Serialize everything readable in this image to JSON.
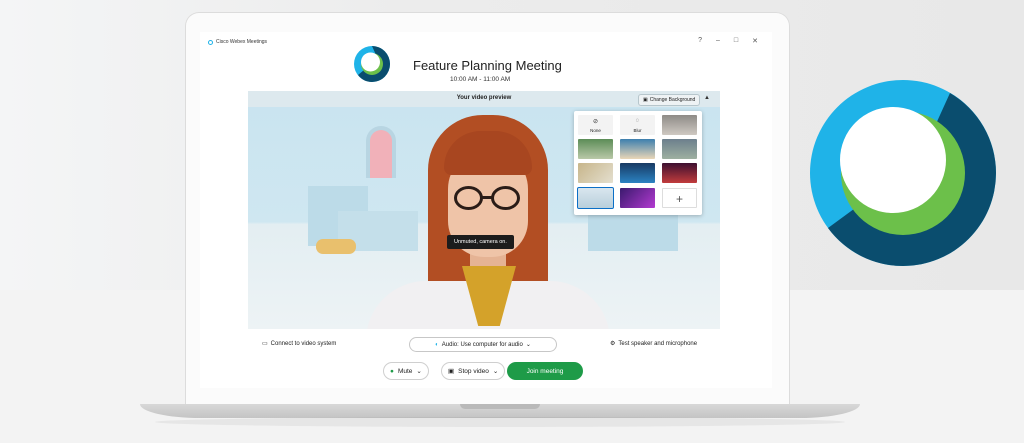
{
  "window": {
    "app_name": "Cisco Webex Meetings",
    "controls": [
      "?",
      "–",
      "□",
      "✕"
    ]
  },
  "meeting": {
    "title": "Feature Planning Meeting",
    "time": "10:00 AM - 11:00 AM"
  },
  "preview": {
    "title": "Your video preview",
    "change_background_label": "Change Background",
    "toast": "Unmuted, camera on.",
    "backgrounds": [
      {
        "label": "None",
        "icon": "⊘"
      },
      {
        "label": "Blur",
        "icon": "◌"
      },
      {
        "label": "",
        "icon": ""
      },
      {
        "label": "",
        "icon": ""
      },
      {
        "label": "",
        "icon": ""
      },
      {
        "label": "",
        "icon": ""
      },
      {
        "label": "",
        "icon": ""
      },
      {
        "label": "",
        "icon": ""
      },
      {
        "label": "",
        "icon": ""
      },
      {
        "label": "",
        "icon": ""
      },
      {
        "label": "",
        "icon": ""
      },
      {
        "label": "",
        "icon": "+"
      }
    ]
  },
  "bottom": {
    "connect_label": "Connect to video system",
    "audio_label": "Audio: Use computer for audio",
    "test_label": "Test speaker and microphone"
  },
  "controls": {
    "mute_label": "Mute",
    "stop_video_label": "Stop video",
    "join_label": "Join meeting"
  },
  "colors": {
    "join_green": "#1e9b48",
    "logo_blue": "#1fb3e8",
    "logo_dark": "#0a4d6e",
    "logo_green": "#6cc04a"
  }
}
